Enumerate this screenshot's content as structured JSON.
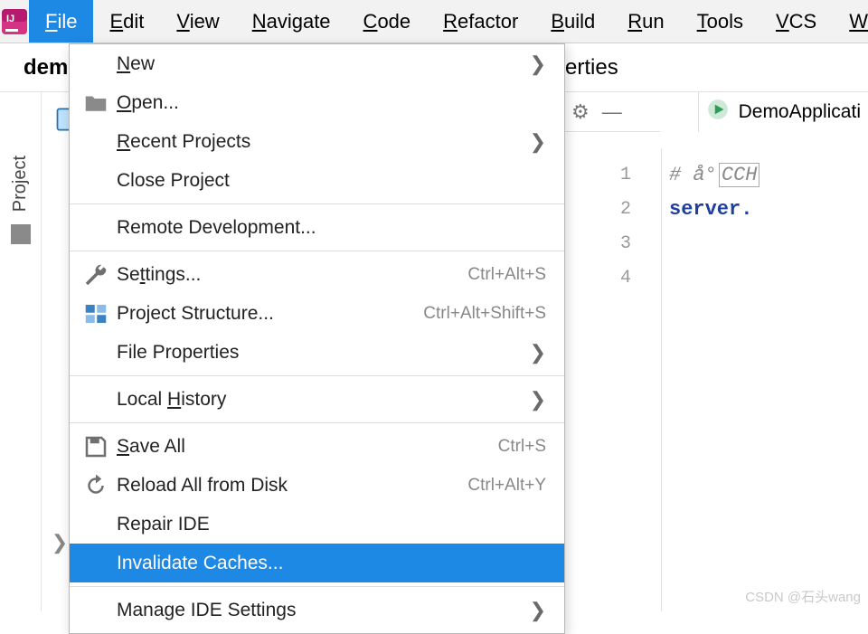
{
  "menubar": {
    "items": [
      "File",
      "Edit",
      "View",
      "Navigate",
      "Code",
      "Refactor",
      "Build",
      "Run",
      "Tools",
      "VCS",
      "W"
    ],
    "active_index": 0
  },
  "breadcrumb_left": "dem",
  "properties_tab_suffix": "erties",
  "file_menu": {
    "groups": [
      [
        {
          "label": "New",
          "icon": "",
          "arrow": true,
          "mnemonic_idx": 0
        },
        {
          "label": "Open...",
          "icon": "folder",
          "mnemonic_idx": 0
        },
        {
          "label": "Recent Projects",
          "icon": "",
          "arrow": true,
          "mnemonic_idx": 0
        },
        {
          "label": "Close Project",
          "icon": ""
        }
      ],
      [
        {
          "label": "Remote Development...",
          "icon": ""
        }
      ],
      [
        {
          "label": "Settings...",
          "icon": "wrench",
          "shortcut": "Ctrl+Alt+S",
          "mnemonic_idx": 2
        },
        {
          "label": "Project Structure...",
          "icon": "proj",
          "shortcut": "Ctrl+Alt+Shift+S"
        },
        {
          "label": "File Properties",
          "icon": "",
          "arrow": true
        }
      ],
      [
        {
          "label": "Local History",
          "icon": "",
          "arrow": true,
          "mnemonic_idx": 6
        }
      ],
      [
        {
          "label": "Save All",
          "icon": "save",
          "shortcut": "Ctrl+S",
          "mnemonic_idx": 0
        },
        {
          "label": "Reload All from Disk",
          "icon": "reload",
          "shortcut": "Ctrl+Alt+Y"
        },
        {
          "label": "Repair IDE",
          "icon": ""
        },
        {
          "label": "Invalidate Caches...",
          "icon": "",
          "highlight": true
        }
      ],
      [
        {
          "label": "Manage IDE Settings",
          "icon": "",
          "arrow": true
        }
      ]
    ]
  },
  "toolstrip": {
    "label": "Project"
  },
  "editor": {
    "tab_label": "DemoApplicati",
    "line_numbers": [
      "1",
      "2",
      "3",
      "4"
    ],
    "line1_comment_prefix": "# å°",
    "line1_box": "CCH",
    "line2_key": "server."
  },
  "watermark": "CSDN @石头wang"
}
